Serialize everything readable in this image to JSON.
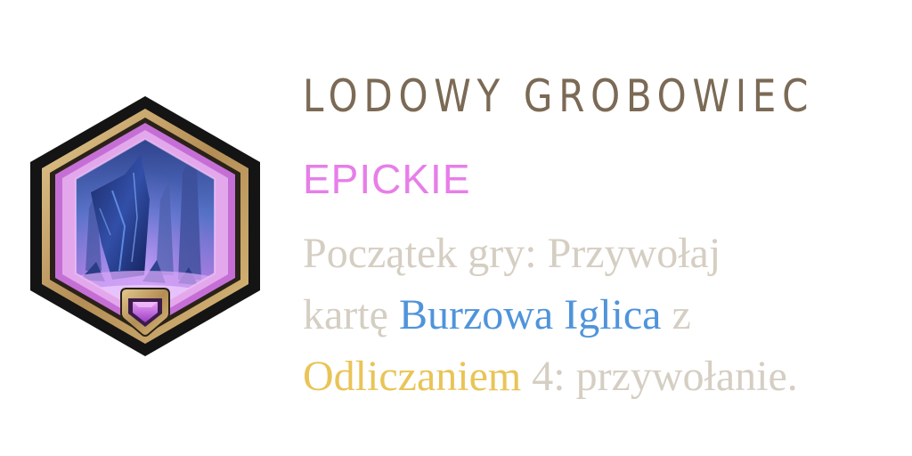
{
  "item": {
    "name": "LODOWY GROBOWIEC",
    "rarity": "EPICKIE",
    "icon": "ice-crystal-tomb-icon",
    "rarity_gem_icon": "pentagon-gem-icon"
  },
  "description": {
    "line1": "Początek gry: Przywołaj",
    "line2_prefix": "kartę ",
    "card_name": "Burzowa Iglica",
    "line2_suffix": " z",
    "keyword": "Odliczaniem",
    "line3_suffix": " 4: przywołanie."
  },
  "colors": {
    "title": "#7b6a55",
    "rarity": "#e77ee9",
    "text": "#d5cec2",
    "card_highlight": "#4f94db",
    "keyword_highlight": "#e9c456",
    "frame_gold": "#c9a56b",
    "frame_inner": "#c56fd6"
  }
}
